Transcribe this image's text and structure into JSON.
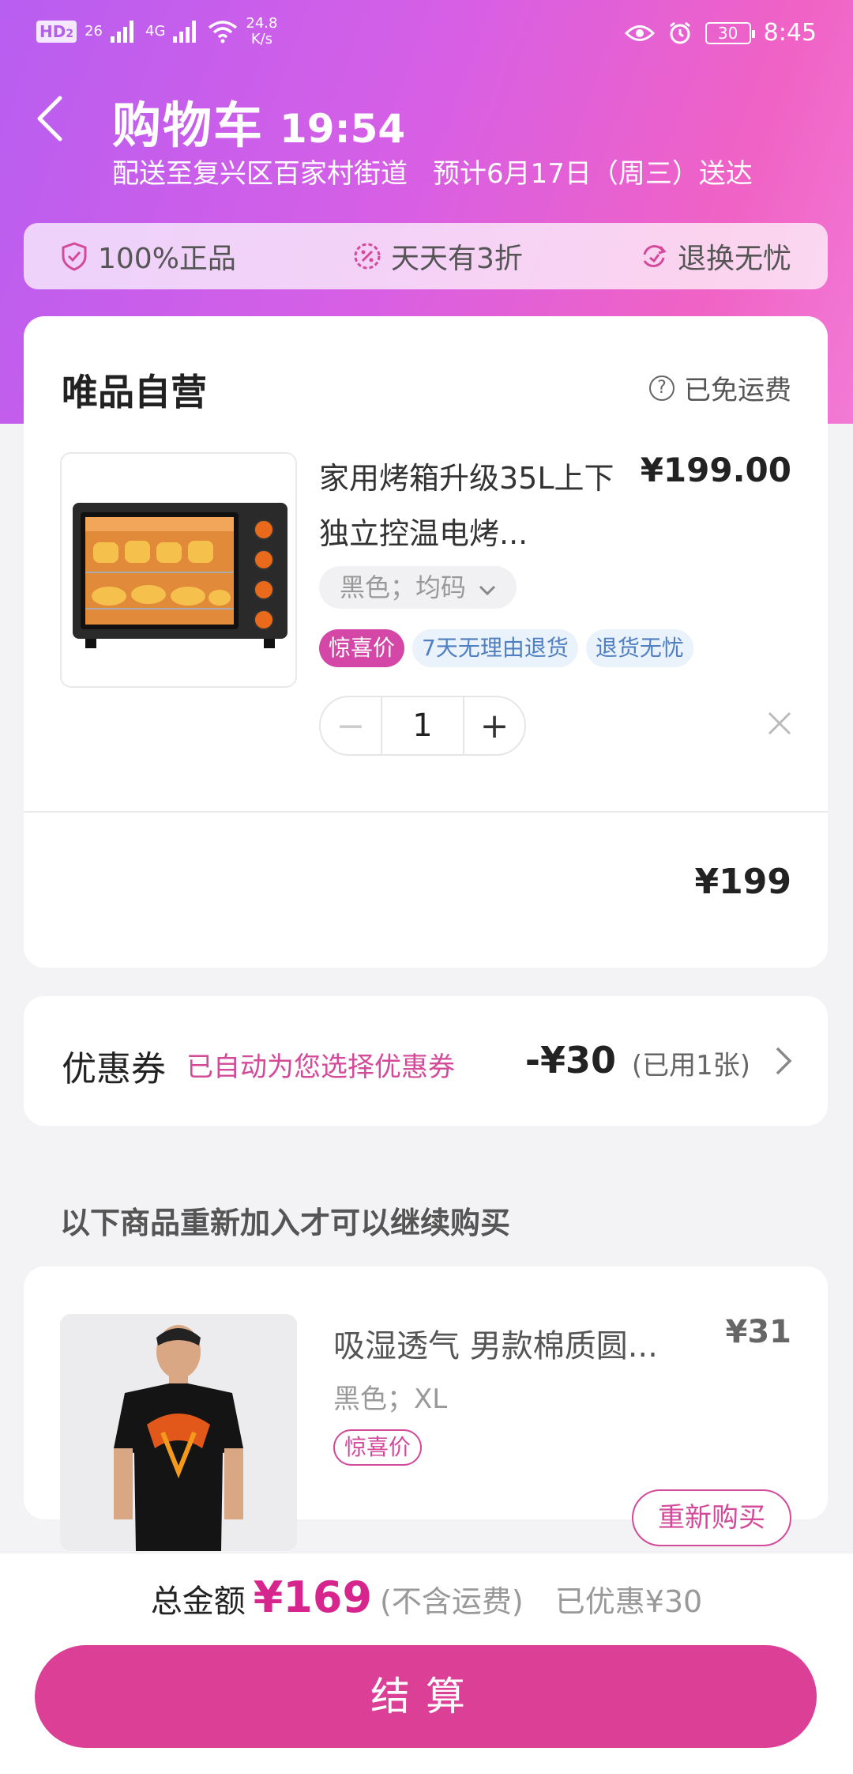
{
  "status_bar": {
    "net_badge": "HD",
    "net_badge_sub": "2",
    "sig1": "26",
    "sig2": "4G",
    "speed": "24.8",
    "speed_unit": "K/s",
    "battery": "30",
    "time": "8:45"
  },
  "header": {
    "title": "购物车",
    "timer": "19:54",
    "delivery_address": "配送至复兴区百家村街道",
    "delivery_eta": "预计6月17日（周三）送达"
  },
  "badges": [
    {
      "label": "100%正品",
      "icon": "shield-check-icon"
    },
    {
      "label": "天天有3折",
      "icon": "percent-badge-icon"
    },
    {
      "label": "退换无忧",
      "icon": "exchange-icon"
    }
  ],
  "shop": {
    "name": "唯品自营",
    "shipping": "已免运费",
    "subtotal": "¥199"
  },
  "item": {
    "title": "家用烤箱升级35L上下独立控温电烤...",
    "price": "¥199.00",
    "sku": "黑色；均码",
    "tags": [
      "惊喜价",
      "7天无理由退货",
      "退货无忧"
    ],
    "qty": "1",
    "qty_minus": "−",
    "qty_plus": "+"
  },
  "coupon": {
    "label": "优惠券",
    "auto_text": "已自动为您选择优惠券",
    "amount": "-¥30",
    "used": "(已用1张)"
  },
  "reorder": {
    "heading": "以下商品重新加入才可以继续购买",
    "title": "吸湿透气 男款棉质圆...",
    "price": "¥31",
    "sku": "黑色；XL",
    "tag": "惊喜价",
    "button": "重新购买"
  },
  "footer": {
    "total_label": "总金额",
    "total": "¥169",
    "note": "(不含运费)",
    "saved": "已优惠¥30",
    "checkout": "结算"
  },
  "colors": {
    "accent": "#dc3f96",
    "price_pink": "#d6268e",
    "hero_start": "#b85ef0",
    "hero_end": "#f27ad6"
  }
}
